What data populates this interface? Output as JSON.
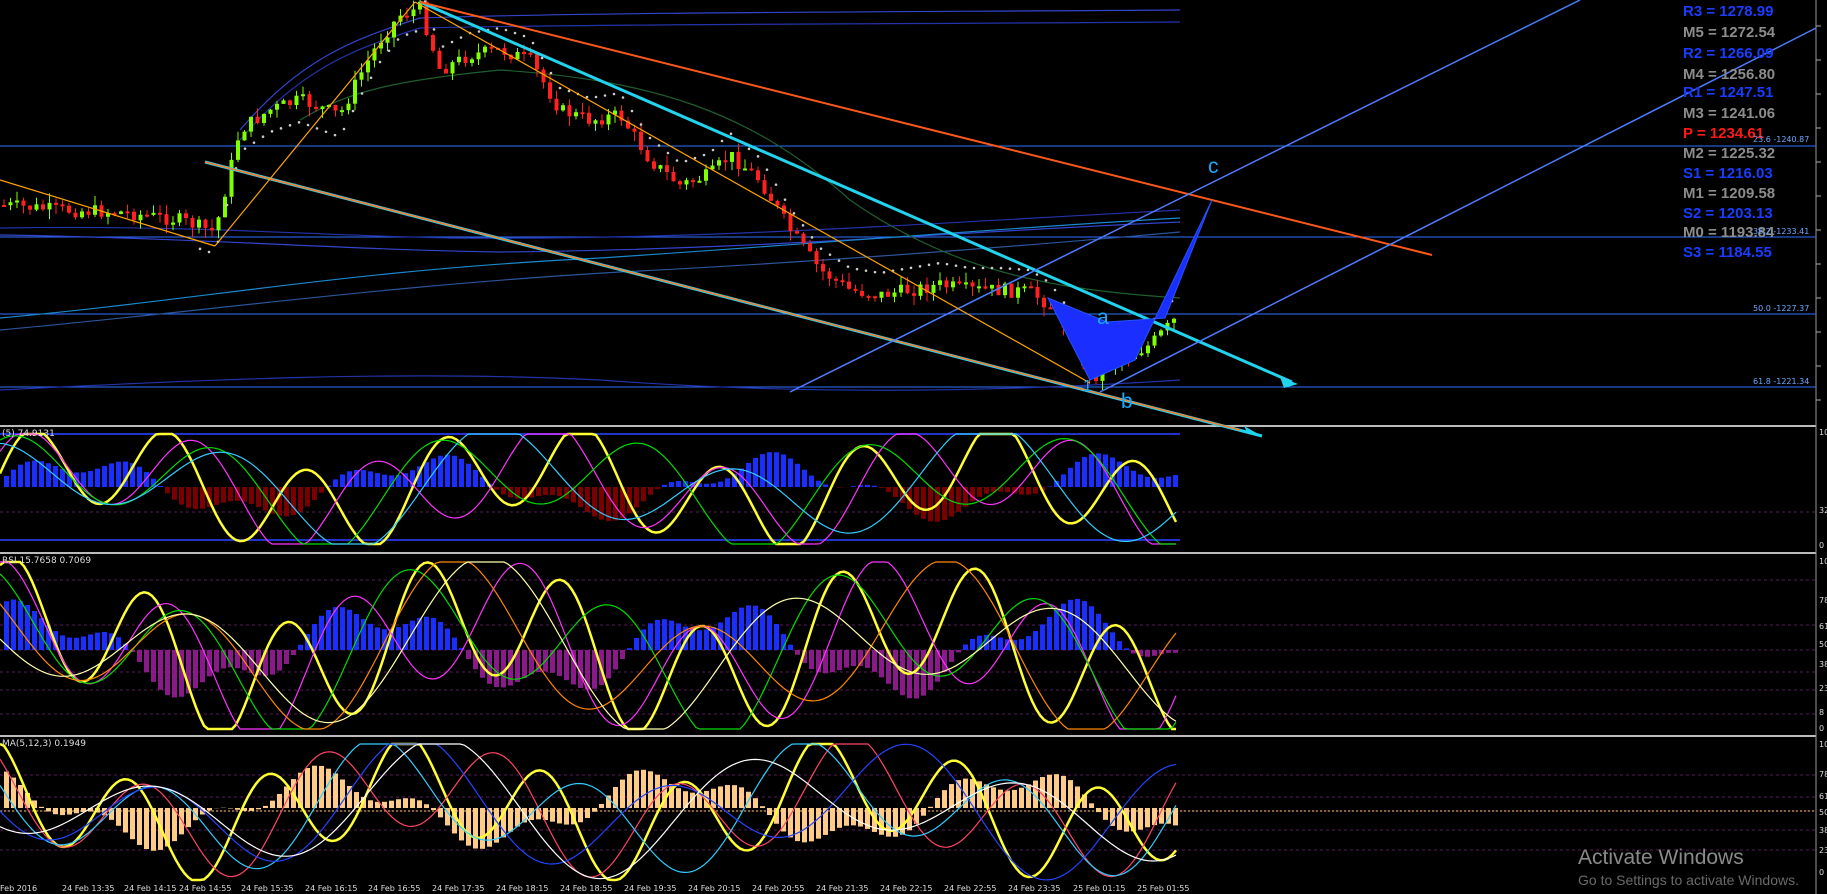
{
  "pivots": [
    {
      "label": "R3 = 1278.99",
      "color": "#1a3cff"
    },
    {
      "label": "M5 = 1272.54",
      "color": "#8c8c8c"
    },
    {
      "label": "R2 = 1266.09",
      "color": "#1a3cff"
    },
    {
      "label": "M4 = 1256.80",
      "color": "#8c8c8c"
    },
    {
      "label": "R1 = 1247.51",
      "color": "#1a3cff"
    },
    {
      "label": "M3 = 1241.06",
      "color": "#8c8c8c"
    },
    {
      "label": "P  = 1234.61",
      "color": "#ff1a1a"
    },
    {
      "label": "M2 = 1225.32",
      "color": "#8c8c8c"
    },
    {
      "label": "S1 = 1216.03",
      "color": "#1a3cff"
    },
    {
      "label": "M1 = 1209.58",
      "color": "#8c8c8c"
    },
    {
      "label": "S2 = 1203.13",
      "color": "#1a3cff"
    },
    {
      "label": "M0 = 1193.84",
      "color": "#8c8c8c"
    },
    {
      "label": "S3 = 1184.55",
      "color": "#1a3cff"
    }
  ],
  "fib_labels": {
    "f236": "23.6 -1240.87",
    "f382": "38.2 -1233.41",
    "f500": "50.0 -1227.37",
    "f618": "61.8 -1221.34"
  },
  "wave_labels": {
    "a": "a",
    "b": "b",
    "c": "c",
    "one": "1"
  },
  "panels": {
    "p1": {
      "title": "(5) 74.9131",
      "scale": [
        "10",
        "32",
        "0"
      ]
    },
    "p2": {
      "title": "RSI 15.7658 0.7069",
      "scale": [
        "10",
        "78",
        "61",
        "50",
        "38",
        "23",
        "8",
        "0"
      ]
    },
    "p3": {
      "title": "MA(5,12,3) 0.1949",
      "scale": [
        "10",
        "78",
        "61",
        "50",
        "38",
        "23",
        "0"
      ]
    }
  },
  "x_axis": [
    "Feb 2016",
    "24 Feb 13:35",
    "24 Feb 14:15",
    "24 Feb 14:55",
    "24 Feb 15:35",
    "24 Feb 16:15",
    "24 Feb 16:55",
    "24 Feb 17:35",
    "24 Feb 18:15",
    "24 Feb 18:55",
    "24 Feb 19:35",
    "24 Feb 20:15",
    "24 Feb 20:55",
    "24 Feb 21:35",
    "24 Feb 22:15",
    "24 Feb 22:55",
    "24 Feb 23:35",
    "25 Feb 01:15",
    "25 Feb 01:55"
  ],
  "watermark": {
    "line1": "Activate Windows",
    "line2": "Go to Settings to activate Windows."
  },
  "colors": {
    "bull": "#7fff00",
    "bear": "#ff2020",
    "cyan": "#22d3ee",
    "orange": "#ff5a1a",
    "blue_line": "#4d7cff",
    "yellow": "#ffff33"
  }
}
